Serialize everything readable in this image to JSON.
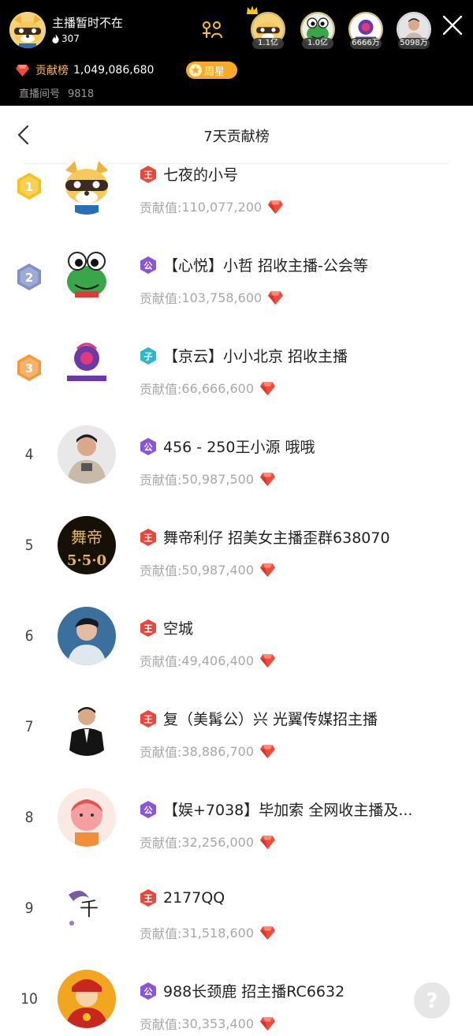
{
  "header": {
    "host_name": "主播暂时不在",
    "hot_count": "307",
    "contribution_label": "贡献榜",
    "contribution_value": "1,049,086,680",
    "week_star_label": "周星",
    "room_label": "直播间号",
    "room_id": "9818",
    "top_viewers": [
      {
        "value": "1.1亿",
        "icon": "raccoon-avatar"
      },
      {
        "value": "1.0亿",
        "icon": "frog-avatar"
      },
      {
        "value": "6666万",
        "icon": "jingyun-logo-avatar"
      },
      {
        "value": "5098万",
        "icon": "man-photo-avatar"
      }
    ],
    "icons": [
      "flame-icon",
      "follow-icon",
      "crown-icon",
      "close-icon",
      "gem-icon",
      "star-icon"
    ]
  },
  "subheader": {
    "title": "7天贡献榜",
    "back_icon": "chevron-left-icon"
  },
  "colors": {
    "header_bg": "#000000",
    "accent_orange": "#f7a928",
    "contribution_label": "#ffb84a",
    "gem_red": "#f04a3a",
    "badge_red": "#e8473a",
    "badge_purple": "#8a55d6",
    "badge_teal": "#2fb8c9",
    "medal_gold": "#f4c21b",
    "medal_silver": "#7e8fc9",
    "medal_bronze": "#f29a3c"
  },
  "ranking": {
    "score_label": "贡献值: ",
    "rows": [
      {
        "rank": "1",
        "medal": "gold",
        "badge": "王",
        "badge_color": "red",
        "name": "七夜的小号",
        "score": "110,077,200",
        "avatar": "raccoon-avatar"
      },
      {
        "rank": "2",
        "medal": "silver",
        "badge": "公",
        "badge_color": "purple",
        "name": "【心悦】小哲  招收主播-公会等",
        "score": "103,758,600",
        "avatar": "frog-avatar"
      },
      {
        "rank": "3",
        "medal": "bronze",
        "badge": "子",
        "badge_color": "teal",
        "name": "【京云】小小北京 招收主播",
        "score": "66,666,600",
        "avatar": "jingyun-logo-avatar"
      },
      {
        "rank": "4",
        "medal": "",
        "badge": "公",
        "badge_color": "purple",
        "name": "456 - 250王小源 哦哦",
        "score": "50,987,500",
        "avatar": "man-photo-avatar"
      },
      {
        "rank": "5",
        "medal": "",
        "badge": "王",
        "badge_color": "red",
        "name": "舞帝利仔  招美女主播歪群638070",
        "score": "50,987,400",
        "avatar": "wudi-550-logo-avatar"
      },
      {
        "rank": "6",
        "medal": "",
        "badge": "王",
        "badge_color": "red",
        "name": "空城",
        "score": "49,406,400",
        "avatar": "man-portrait-avatar"
      },
      {
        "rank": "7",
        "medal": "",
        "badge": "王",
        "badge_color": "red",
        "name": "复（美髯公）兴 光翼传媒招主播",
        "score": "38,886,700",
        "avatar": "man-suit-avatar"
      },
      {
        "rank": "8",
        "medal": "",
        "badge": "公",
        "badge_color": "purple",
        "name": "【娱+7038】毕加索 全网收主播及...",
        "score": "32,256,000",
        "avatar": "cartoon-face-avatar"
      },
      {
        "rank": "9",
        "medal": "",
        "badge": "王",
        "badge_color": "red",
        "name": "2177QQ",
        "score": "31,518,600",
        "avatar": "calligraphy-avatar"
      },
      {
        "rank": "10",
        "medal": "",
        "badge": "公",
        "badge_color": "purple",
        "name": "988长颈鹿 招主播RC6632",
        "score": "30,353,400",
        "avatar": "god-of-wealth-avatar"
      }
    ]
  },
  "help_icon": "question-icon"
}
